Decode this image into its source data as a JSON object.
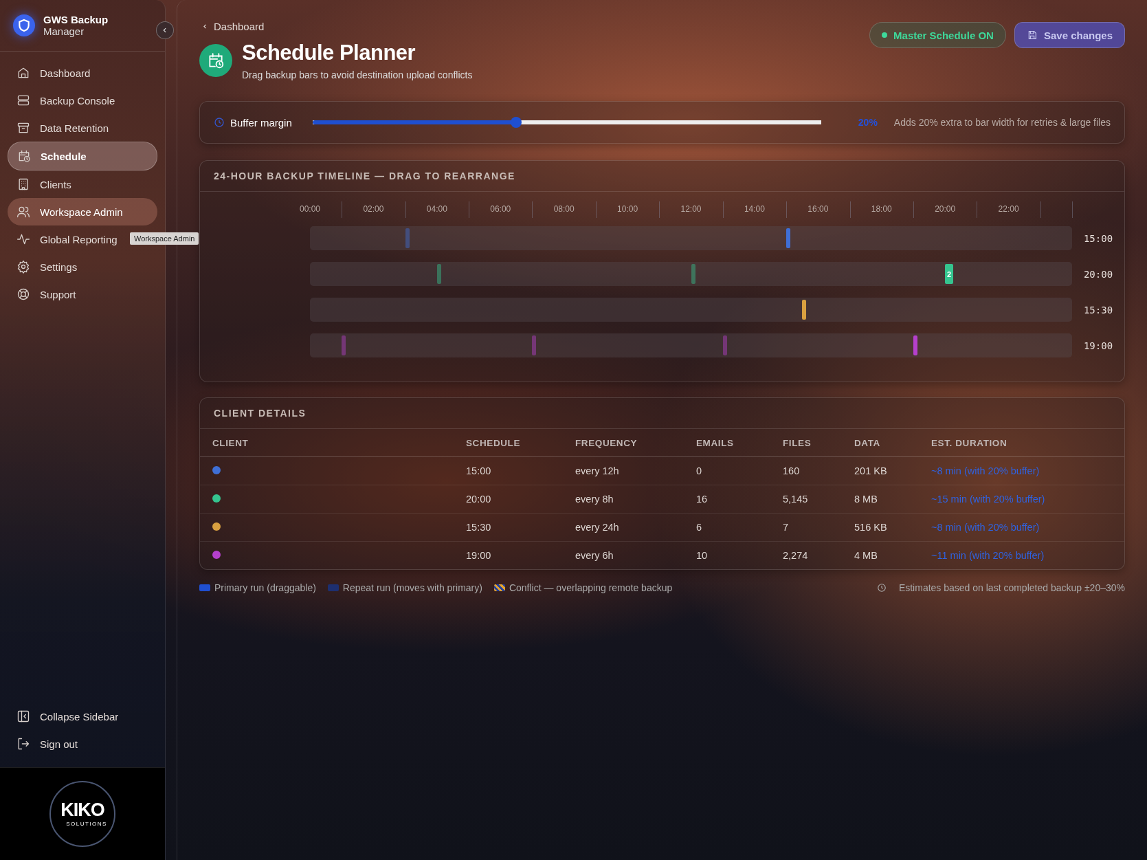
{
  "sidebar": {
    "brand": {
      "title": "GWS Backup",
      "subtitle": "Manager"
    },
    "items": [
      {
        "label": "Dashboard",
        "selected": false,
        "hovered": false
      },
      {
        "label": "Backup Console",
        "selected": false,
        "hovered": false
      },
      {
        "label": "Data Retention",
        "selected": false,
        "hovered": false
      },
      {
        "label": "Schedule",
        "selected": true,
        "hovered": false
      },
      {
        "label": "Clients",
        "selected": false,
        "hovered": false
      },
      {
        "label": "Workspace Admin",
        "selected": false,
        "hovered": true
      },
      {
        "label": "Global Reporting",
        "selected": false,
        "hovered": false
      },
      {
        "label": "Settings",
        "selected": false,
        "hovered": false
      },
      {
        "label": "Support",
        "selected": false,
        "hovered": false
      }
    ],
    "tooltip": "Workspace Admin",
    "footer_items": [
      {
        "label": "Collapse Sidebar"
      },
      {
        "label": "Sign out"
      }
    ],
    "logo": {
      "name": "KIKO",
      "tagline": "SOLUTIONS"
    }
  },
  "header": {
    "breadcrumb": "Dashboard",
    "title": "Schedule Planner",
    "subtitle": "Drag backup bars to avoid destination upload conflicts",
    "master": {
      "label": "Master Schedule ON",
      "on": true
    },
    "save": {
      "label": "Save changes",
      "disabled": true
    }
  },
  "buffer": {
    "label": "Buffer margin",
    "level": 0.4,
    "value": "20%",
    "hint": "Adds 20% extra to bar width for retries & large files"
  },
  "timeline": {
    "title": "24-HOUR BACKUP TIMELINE — DRAG TO REARRANGE",
    "hours": [
      "00:00",
      "02:00",
      "04:00",
      "06:00",
      "08:00",
      "10:00",
      "12:00",
      "14:00",
      "16:00",
      "18:00",
      "20:00",
      "22:00"
    ],
    "rows": [
      {
        "time": "15:00"
      },
      {
        "time": "20:00",
        "badge": "2"
      },
      {
        "time": "15:30"
      },
      {
        "time": "19:00"
      }
    ]
  },
  "client_details": {
    "title": "CLIENT DETAILS",
    "columns": [
      "CLIENT",
      "SCHEDULE",
      "FREQUENCY",
      "EMAILS",
      "FILES",
      "DATA",
      "EST. DURATION"
    ],
    "rows": [
      {
        "color": "#3f6fd6",
        "schedule": "15:00",
        "frequency": "every 12h",
        "emails": "0",
        "files": "160",
        "data": "201 KB",
        "duration": "~8 min (with 20% buffer)"
      },
      {
        "color": "#35c48f",
        "schedule": "20:00",
        "frequency": "every 8h",
        "emails": "16",
        "files": "5,145",
        "data": "8 MB",
        "duration": "~15 min (with 20% buffer)"
      },
      {
        "color": "#d9a040",
        "schedule": "15:30",
        "frequency": "every 24h",
        "emails": "6",
        "files": "7",
        "data": "516 KB",
        "duration": "~8 min (with 20% buffer)"
      },
      {
        "color": "#b540cc",
        "schedule": "19:00",
        "frequency": "every 6h",
        "emails": "10",
        "files": "2,274",
        "data": "4 MB",
        "duration": "~11 min (with 20% buffer)"
      }
    ]
  },
  "legend": {
    "items": [
      {
        "kind": "primary",
        "label": "Primary run (draggable)"
      },
      {
        "kind": "repeat",
        "label": "Repeat run (moves with primary)"
      },
      {
        "kind": "conflict",
        "label": "Conflict — overlapping remote backup"
      }
    ],
    "note": "Estimates based on last completed backup ±20–30%"
  }
}
